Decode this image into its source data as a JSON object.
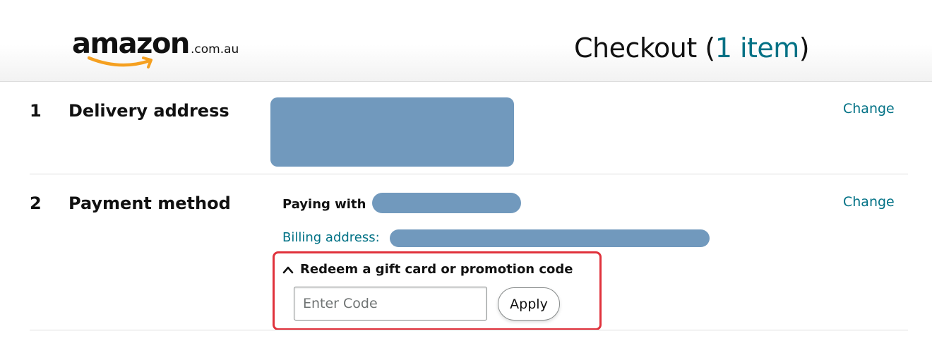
{
  "header": {
    "logo_word": "amazon",
    "logo_suffix": ".com.au",
    "title_prefix": "Checkout (",
    "item_count": "1 item",
    "title_suffix": ")"
  },
  "sections": [
    {
      "number": "1",
      "title": "Delivery address",
      "change_label": "Change"
    },
    {
      "number": "2",
      "title": "Payment method",
      "change_label": "Change",
      "paying_with_label": "Paying with",
      "billing_label": "Billing address:",
      "promo": {
        "toggle_label": "Redeem a gift card or promotion code",
        "input_placeholder": "Enter Code",
        "apply_label": "Apply"
      }
    }
  ],
  "colors": {
    "link": "#007185",
    "redaction": "#7199bd",
    "highlight_border": "#e0323c",
    "logo_smile": "#f5a020"
  }
}
